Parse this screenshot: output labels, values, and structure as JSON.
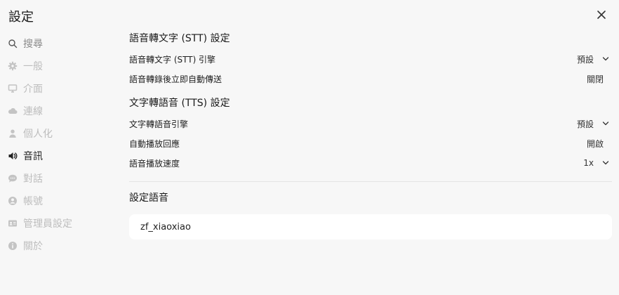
{
  "title": "設定",
  "sidebar": {
    "items": [
      {
        "label": "搜尋",
        "icon": "search-icon"
      },
      {
        "label": "一般",
        "icon": "gear-icon"
      },
      {
        "label": "介面",
        "icon": "monitor-icon"
      },
      {
        "label": "連線",
        "icon": "cloud-icon"
      },
      {
        "label": "個人化",
        "icon": "user-icon"
      },
      {
        "label": "音訊",
        "icon": "speaker-icon",
        "active": true
      },
      {
        "label": "對話",
        "icon": "chat-bubble-icon"
      },
      {
        "label": "帳號",
        "icon": "account-circle-icon"
      },
      {
        "label": "管理員設定",
        "icon": "id-card-icon"
      },
      {
        "label": "關於",
        "icon": "info-icon"
      }
    ]
  },
  "stt": {
    "title": "語音轉文字 (STT) 設定",
    "engine_label": "語音轉文字 (STT) 引擎",
    "engine_value": "預設",
    "autosend_label": "語音轉錄後立即自動傳送",
    "autosend_value": "關閉"
  },
  "tts": {
    "title": "文字轉語音 (TTS) 設定",
    "engine_label": "文字轉語音引擎",
    "engine_value": "預設",
    "autoplay_label": "自動播放回應",
    "autoplay_value": "開啟",
    "speed_label": "語音播放速度",
    "speed_value": "1x"
  },
  "voice": {
    "title": "設定語音",
    "value": "zf_xiaoxiao"
  }
}
